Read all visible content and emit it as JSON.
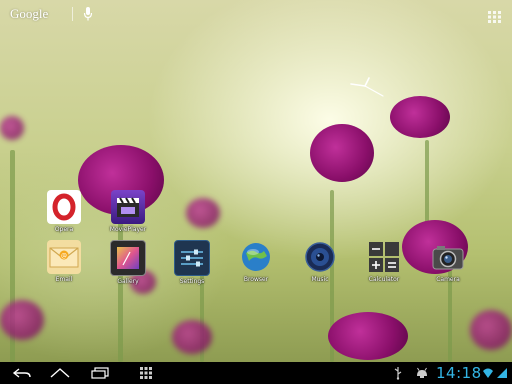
{
  "search": {
    "logo_text": "Google",
    "mic_icon": "microphone-icon",
    "apps_icon": "app-drawer-grid-icon"
  },
  "clock": {
    "icon": "analog-clock-widget"
  },
  "apps": [
    {
      "label": "Opera",
      "icon": "opera-icon"
    },
    {
      "label": "MoviePlayer",
      "icon": "movie-clapper-icon"
    },
    {
      "label": "Email",
      "icon": "email-envelope-icon"
    },
    {
      "label": "Gallery",
      "icon": "gallery-icon"
    },
    {
      "label": "Settings",
      "icon": "settings-sliders-icon"
    },
    {
      "label": "Browser",
      "icon": "globe-icon"
    },
    {
      "label": "Music",
      "icon": "speaker-icon"
    },
    {
      "label": "Calculator",
      "icon": "calculator-icon"
    },
    {
      "label": "Camera",
      "icon": "camera-icon"
    }
  ],
  "navbar": {
    "back_icon": "back-arrow-icon",
    "home_icon": "home-icon",
    "recents_icon": "recent-apps-icon",
    "menu_icon": "menu-grid-icon",
    "usb_icon": "usb-icon",
    "debug_icon": "android-debug-icon",
    "time": "14:18",
    "wifi_icon": "wifi-icon",
    "signal_icon": "signal-icon"
  },
  "colors": {
    "clock_time": "#33b5e5",
    "navbar_bg": "#000000"
  }
}
